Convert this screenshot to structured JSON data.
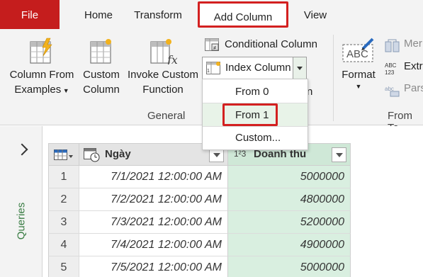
{
  "tabs": {
    "file": "File",
    "home": "Home",
    "transform": "Transform",
    "add_column": "Add Column",
    "view": "View"
  },
  "ribbon": {
    "column_from_examples": [
      "Column From",
      "Examples"
    ],
    "custom_column": [
      "Custom",
      "Column"
    ],
    "invoke_custom_function": [
      "Invoke Custom",
      "Function"
    ],
    "conditional_column": "Conditional Column",
    "index_column": "Index Column",
    "format": "Format",
    "group_general": "General",
    "group_from_text": "From Te",
    "merge_partial": "Mer",
    "extract_partial": "Extr",
    "parse_partial": "Pars",
    "hidden_partial": "n"
  },
  "index_dropdown": {
    "options": [
      "From 0",
      "From 1",
      "Custom..."
    ],
    "selected": "From 1"
  },
  "queries_label": "Queries",
  "grid": {
    "columns": [
      {
        "name": "Ngày",
        "type_icon": "datetime-icon"
      },
      {
        "name": "Doanh thu",
        "type_icon": "1²3"
      }
    ],
    "rows": [
      {
        "n": "1",
        "date": "7/1/2021 12:00:00 AM",
        "value": "5000000"
      },
      {
        "n": "2",
        "date": "7/2/2021 12:00:00 AM",
        "value": "4800000"
      },
      {
        "n": "3",
        "date": "7/3/2021 12:00:00 AM",
        "value": "5200000"
      },
      {
        "n": "4",
        "date": "7/4/2021 12:00:00 AM",
        "value": "4900000"
      },
      {
        "n": "5",
        "date": "7/5/2021 12:00:00 AM",
        "value": "5000000"
      }
    ]
  },
  "colors": {
    "file_tab": "#c51d1d",
    "highlight": "#d32020",
    "selected_column": "#d9efe0",
    "queries_label": "#3a7d44"
  }
}
